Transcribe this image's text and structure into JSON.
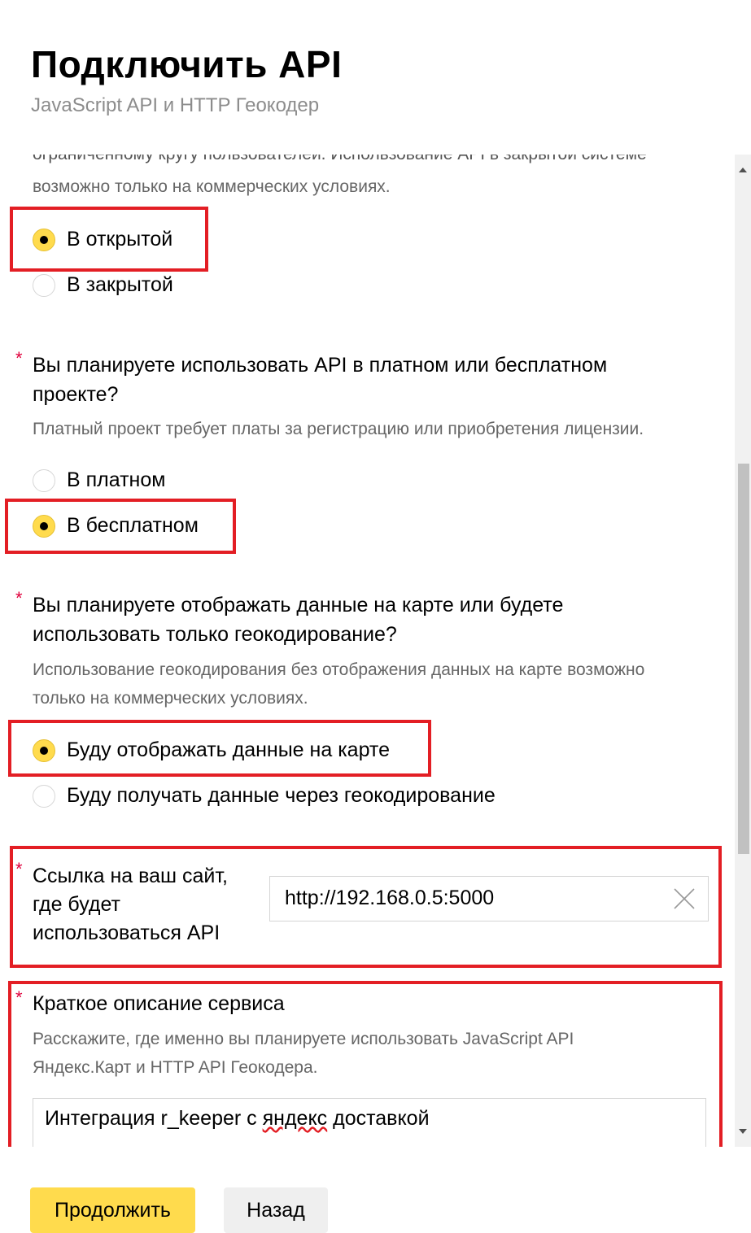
{
  "header": {
    "title": "Подключить API",
    "subtitle": "JavaScript API и HTTP Геокодер"
  },
  "section_access": {
    "hint_top_cut": "ограниченному кругу пользователей. Использование API в закрытой системе",
    "hint_bottom": "возможно только на коммерческих условиях.",
    "options": [
      {
        "label": "В открытой",
        "checked": true
      },
      {
        "label": "В закрытой",
        "checked": false
      }
    ]
  },
  "section_paid": {
    "required_mark": "*",
    "question_line1": "Вы планируете использовать API в платном или бесплатном",
    "question_line2": "проекте?",
    "hint": "Платный проект требует платы за регистрацию или приобретения лицензии.",
    "options": [
      {
        "label": "В платном",
        "checked": false
      },
      {
        "label": "В бесплатном",
        "checked": true
      }
    ]
  },
  "section_display": {
    "required_mark": "*",
    "question_line1": "Вы планируете отображать данные на карте или будете",
    "question_line2": "использовать только геокодирование?",
    "hint_line1": "Использование геокодирования без отображения данных на карте возможно",
    "hint_line2": "только на коммерческих условиях.",
    "options": [
      {
        "label": "Буду отображать данные на карте",
        "checked": true
      },
      {
        "label": "Буду получать данные через геокодирование",
        "checked": false
      }
    ]
  },
  "section_site": {
    "required_mark": "*",
    "label_line1": "Ссылка на ваш сайт,",
    "label_line2": "где будет",
    "label_line3": "использоваться API",
    "value": "http://192.168.0.5:5000"
  },
  "section_description": {
    "required_mark": "*",
    "label": "Краткое описание сервиса",
    "hint_line1": "Расскажите, где именно вы планируете использовать JavaScript API",
    "hint_line2": "Яндекс.Карт и HTTP API Геокодера.",
    "value_before": "Интеграция r_keeper c ",
    "value_misspelled": "яндекс",
    "value_after": " доставкой"
  },
  "actions": {
    "continue_label": "Продолжить",
    "back_label": "Назад"
  },
  "colors": {
    "accent_yellow": "#ffdb4d",
    "required_red": "#e0003c",
    "highlight_red": "#e31e24",
    "hint_gray": "#666666"
  }
}
